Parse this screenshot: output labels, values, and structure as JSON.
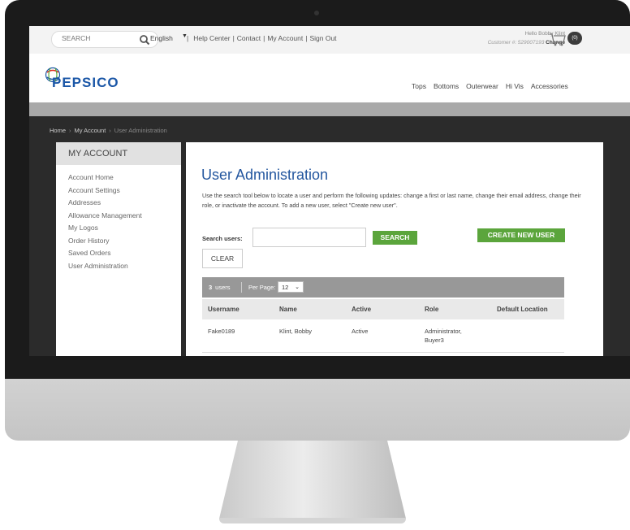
{
  "topbar": {
    "search_placeholder": "SEARCH",
    "language": "English",
    "links": [
      "Help Center",
      "Contact",
      "My Account",
      "Sign Out"
    ],
    "greeting": "Hello Bobby Klint",
    "customer_label": "Customer #: 529007193",
    "change_label": "Change",
    "cart_count": "(0)"
  },
  "brand": {
    "logo_text": "PEPSICO"
  },
  "nav": {
    "items": [
      "Tops",
      "Bottoms",
      "Outerwear",
      "Hi Vis",
      "Accessories"
    ]
  },
  "breadcrumb": {
    "items": [
      "Home",
      "My Account",
      "User Administration"
    ]
  },
  "sidebar": {
    "title": "MY ACCOUNT",
    "items": [
      "Account Home",
      "Account Settings",
      "Addresses",
      "Allowance Management",
      "My Logos",
      "Order History",
      "Saved Orders",
      "User Administration"
    ]
  },
  "main": {
    "title": "User Administration",
    "description": "Use the search tool below to locate a user and perform the following updates: change a first or last name, change their email address, change their role, or inactivate the account. To add a new user, select \"Create new user\".",
    "search_label": "Search users:",
    "search_button": "SEARCH",
    "create_button": "CREATE NEW USER",
    "clear_button": "CLEAR",
    "user_count": "3",
    "users_label": "users",
    "per_page_label": "Per Page:",
    "per_page_value": "12",
    "columns": [
      "Username",
      "Name",
      "Active",
      "Role",
      "Default Location"
    ],
    "rows": [
      {
        "username": "Fake0189",
        "name": "Klint, Bobby",
        "active": "Active",
        "role_line1": "Administrator,",
        "role_line2": "Buyer3",
        "location": ""
      }
    ]
  },
  "colors": {
    "accent_blue": "#24579f",
    "button_green": "#5ba53c",
    "logo_blue": "#1b57a7"
  }
}
